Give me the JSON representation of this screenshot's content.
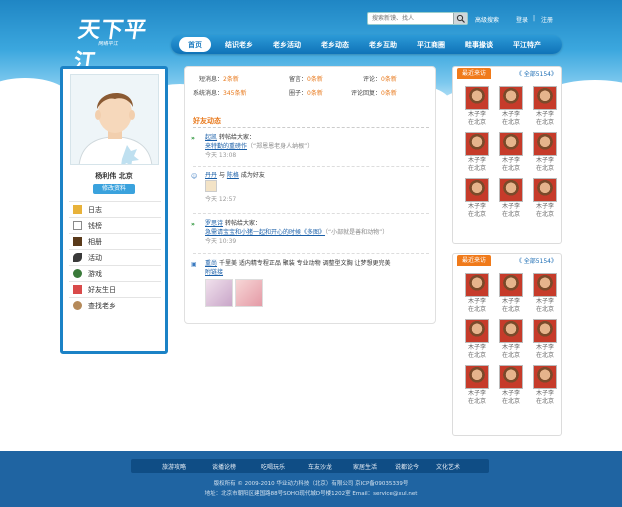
{
  "header": {
    "logo_text": "天下平江",
    "logo_sub": "网络平江",
    "search_placeholder": "搜索新馍、找人",
    "advanced_search": "高级搜索",
    "login": "登录",
    "sep": "|",
    "register": "注册"
  },
  "nav": {
    "items": [
      "首页",
      "结识老乡",
      "老乡活动",
      "老乡动态",
      "老乡互助",
      "平江商圈",
      "畦事掾谈",
      "平江特产"
    ]
  },
  "profile": {
    "name": "杨利伟  北京",
    "edit_label": "修改资料",
    "menu": [
      {
        "label": "日志",
        "icon": "book-icon",
        "color": "#e8b23a"
      },
      {
        "label": "钱榜",
        "icon": "doc-icon",
        "color": "#8a8a8a"
      },
      {
        "label": "相册",
        "icon": "album-icon",
        "color": "#5a3a1a"
      },
      {
        "label": "活动",
        "icon": "telescope-icon",
        "color": "#3a3a3a"
      },
      {
        "label": "游戏",
        "icon": "game-icon",
        "color": "#3a7a3a"
      },
      {
        "label": "好友生日",
        "icon": "gift-icon",
        "color": "#d94a4a"
      },
      {
        "label": "查找老乡",
        "icon": "search-person-icon",
        "color": "#b58a5a"
      }
    ]
  },
  "stats": {
    "s1_label": "短消息：",
    "s1_value": "2条新",
    "s2_label": "留言：",
    "s2_value": "0条新",
    "s3_label": "评论：",
    "s3_value": "0条新",
    "s4_label": "系统消息：",
    "s4_value": "345条新",
    "s5_label": "圈子：",
    "s5_value": "0条新",
    "s6_label": "评论回复：",
    "s6_value": "0条新"
  },
  "feed": {
    "title": "好友动态",
    "entries": [
      {
        "user": "起凯",
        "line1": "转帖给大家：",
        "link": "来特勤的重磅作",
        "quote": "（“郑恩恩老身人纳根”）",
        "time": "今天 13:08"
      },
      {
        "user": "丹丹",
        "mid": "与",
        "user2": "陈格",
        "line1": "成为好友",
        "time": "今天 12:57"
      },
      {
        "user": "罗思诗",
        "line1": "转帖给大家：",
        "link": "急需请宝宝和小猪一起和开心的时候《多图》",
        "quote": "（“小部就是善和动物”）",
        "time": "今天 10:39"
      },
      {
        "user": "重尚",
        "line1": "千里美  适内精专程正品 聚装  专业动物  调整型文胸  让梦想更完美",
        "link": "附链接",
        "time": ""
      }
    ]
  },
  "right": {
    "box1_title": "最近来访",
    "box1_all": "《 全部5154》",
    "box2_title": "最近来访",
    "box2_all": "《 全部5154》",
    "person_name1": "木子李",
    "person_name2": "在北京"
  },
  "footer": {
    "links": [
      "旅游攻略",
      "谈播论榜",
      "吃喝玩乐",
      "车友沙龙",
      "家居生活",
      "说都论今",
      "文化艺术"
    ],
    "copyright": "版权所有 © 2009-2010  华业动力科技（北京）有限公司  京ICP备09035339号",
    "address": "地址：北京市朝阳区建国路88号SOHO现代城D号楼1202室    Email：service@xul.net"
  }
}
